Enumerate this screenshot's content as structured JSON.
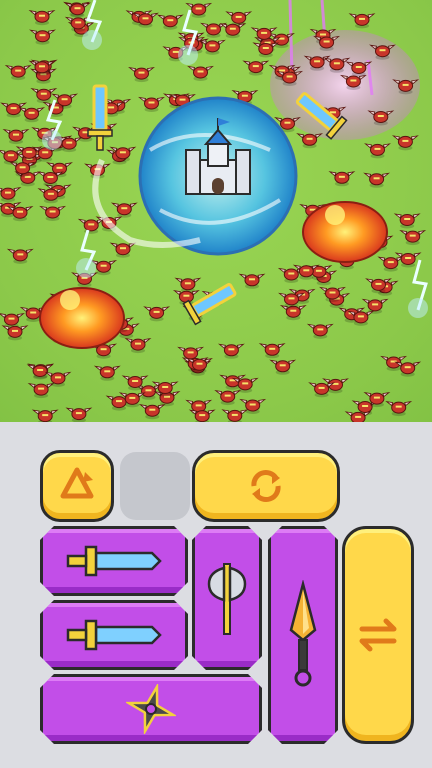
{
  "battlefield": {
    "castle": "castle-icon",
    "shield_color": "#3aa8e8",
    "enemies": "goblin-raider-icons",
    "effects": [
      "lightning-bolt-icon",
      "fire-explosion-icon",
      "purple-magic-icon"
    ]
  },
  "inventory": {
    "recycle_button": {
      "icon": "recycle-icon",
      "color": "#ffd84a"
    },
    "empty_slot": {
      "color": "#c5c7cd"
    },
    "refresh_button": {
      "icon": "refresh-icon",
      "color": "#ffd84a"
    },
    "swap_button": {
      "icon": "swap-arrows-icon",
      "color": "#ffd84a"
    },
    "weapon_slots": [
      {
        "item": "sword-icon",
        "color": "#c24ee8"
      },
      {
        "item": "sword-icon",
        "color": "#c24ee8"
      },
      {
        "item": "shuriken-icon",
        "color": "#c24ee8"
      },
      {
        "item": "axe-icon",
        "color": "#c24ee8"
      },
      {
        "item": "kunai-icon",
        "color": "#c24ee8"
      }
    ]
  }
}
